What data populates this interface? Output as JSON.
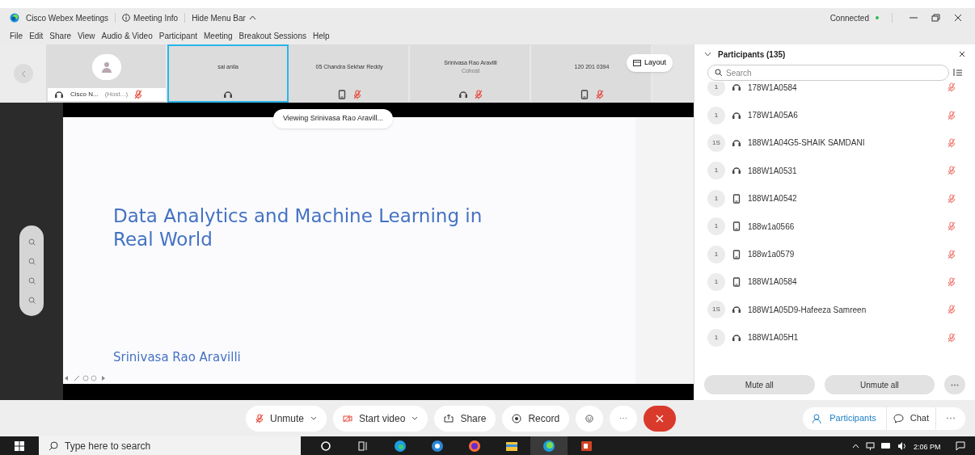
{
  "title_bar": {
    "app_title": "Cisco Webex Meetings",
    "meeting_info": "Meeting Info",
    "hide_menu": "Hide Menu Bar",
    "status": "Connected"
  },
  "menu_bar": [
    "File",
    "Edit",
    "Share",
    "View",
    "Audio & Video",
    "Participant",
    "Meeting",
    "Breakout Sessions",
    "Help"
  ],
  "video_strip": [
    {
      "has_avatar": true,
      "name": "Cisco N...",
      "role": "(Host...)",
      "kind": "headset",
      "muted": true,
      "selected": false
    },
    {
      "has_avatar": false,
      "name": "sai anila",
      "kind": "headset",
      "muted": false,
      "selected": true
    },
    {
      "has_avatar": false,
      "name": "05 Chandra Sekhar Reddy",
      "kind": "phone",
      "muted": true,
      "selected": false
    },
    {
      "has_avatar": false,
      "name": "Srinivasa Rao Aravilli",
      "role": "Cohost",
      "kind": "headset",
      "muted": true,
      "selected": false
    },
    {
      "has_avatar": false,
      "name": "120 201 0394",
      "kind": "phone",
      "muted": true,
      "selected": false
    }
  ],
  "layout_button": "Layout",
  "stage": {
    "viewing": "Viewing Srinivasa Rao Aravill...",
    "slide_title": "Data Analytics and Machine Learning in Real World",
    "slide_author": "Srinivasa Rao Aravilli"
  },
  "participants_panel": {
    "title": "Participants (135)",
    "search": {
      "placeholder": "Search"
    },
    "rows": [
      {
        "badge": "1",
        "kind": "headset",
        "name": "178W1A0584",
        "muted": true
      },
      {
        "badge": "1",
        "kind": "headset",
        "name": "178W1A05A6",
        "muted": true
      },
      {
        "badge": "1S",
        "kind": "headset",
        "name": "188W1A04G5-SHAIK SAMDANI",
        "muted": true
      },
      {
        "badge": "1",
        "kind": "headset",
        "name": "188W1A0531",
        "muted": true
      },
      {
        "badge": "1",
        "kind": "phone",
        "name": "188W1A0542",
        "muted": true
      },
      {
        "badge": "1",
        "kind": "phone",
        "name": "188w1a0566",
        "muted": true
      },
      {
        "badge": "1",
        "kind": "phone",
        "name": "188w1a0579",
        "muted": true
      },
      {
        "badge": "1",
        "kind": "phone",
        "name": "188W1A0584",
        "muted": true
      },
      {
        "badge": "1S",
        "kind": "headset",
        "name": "188W1A05D9-Hafeeza Samreen",
        "muted": true
      },
      {
        "badge": "1",
        "kind": "headset",
        "name": "188W1A05H1",
        "muted": true
      }
    ],
    "buttons": [
      "Mute all",
      "Unmute all"
    ]
  },
  "controls": {
    "unmute": "Unmute",
    "start_video": "Start video",
    "share": "Share",
    "record": "Record",
    "participants": "Participants",
    "chat": "Chat"
  },
  "taskbar": {
    "search": {
      "placeholder": "Type here to search"
    },
    "time": "2:06 PM"
  }
}
